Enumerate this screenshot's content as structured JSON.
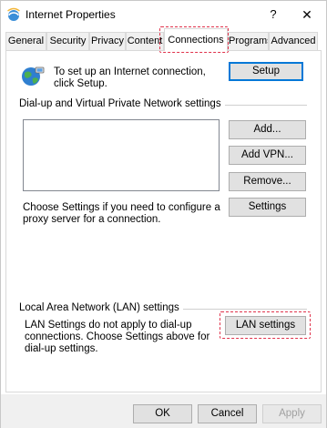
{
  "window": {
    "title": "Internet Properties",
    "help_label": "?",
    "close_label": "✕"
  },
  "tabs": [
    {
      "label": "General"
    },
    {
      "label": "Security"
    },
    {
      "label": "Privacy"
    },
    {
      "label": "Content"
    },
    {
      "label": "Connections",
      "active": true
    },
    {
      "label": "Programs"
    },
    {
      "label": "Advanced"
    }
  ],
  "setup": {
    "text": "To set up an Internet connection, click Setup.",
    "button": "Setup"
  },
  "dialup": {
    "heading": "Dial-up and Virtual Private Network settings",
    "items": [],
    "add_button": "Add...",
    "add_vpn_button": "Add VPN...",
    "remove_button": "Remove...",
    "proxy_text": "Choose Settings if you need to configure a proxy server for a connection.",
    "settings_button": "Settings"
  },
  "lan": {
    "heading": "Local Area Network (LAN) settings",
    "text": "LAN Settings do not apply to dial-up connections. Choose Settings above for dial-up settings.",
    "button": "LAN settings"
  },
  "footer": {
    "ok": "OK",
    "cancel": "Cancel",
    "apply": "Apply"
  }
}
